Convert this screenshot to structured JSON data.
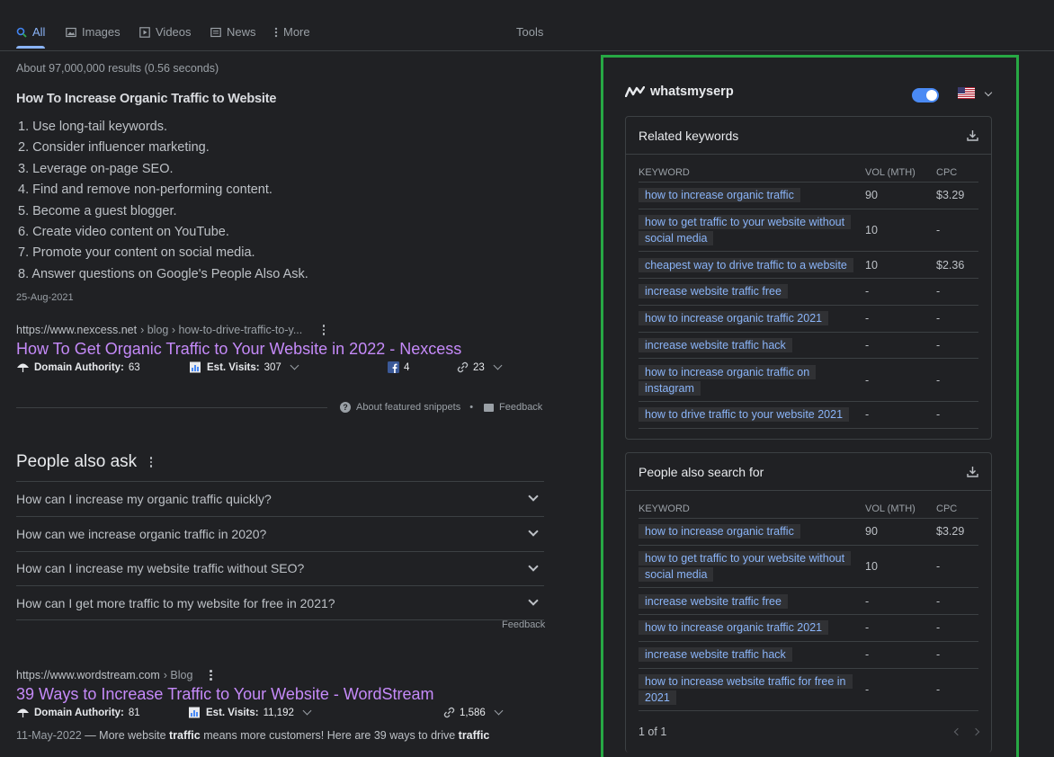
{
  "tabs": [
    {
      "label": "All",
      "icon": "search-icon",
      "active": true
    },
    {
      "label": "Images",
      "icon": "image-icon"
    },
    {
      "label": "Videos",
      "icon": "video-icon"
    },
    {
      "label": "News",
      "icon": "news-icon"
    },
    {
      "label": "More",
      "icon": "more-icon"
    }
  ],
  "tools_label": "Tools",
  "stats": "About 97,000,000 results (0.56 seconds)",
  "snippet": {
    "title": "How To Increase Organic Traffic to Website",
    "items": [
      "1. Use long-tail keywords.",
      "2. Consider influencer marketing.",
      "3. Leverage on-page SEO.",
      "4. Find and remove non-performing content.",
      "5. Become a guest blogger.",
      "6. Create video content on YouTube.",
      "7. Promote your content on social media.",
      "8. Answer questions on Google's People Also Ask."
    ],
    "date": "25-Aug-2021"
  },
  "result1": {
    "url_domain": "https://www.nexcess.net",
    "url_path": "› blog › how-to-drive-traffic-to-y...",
    "title": "How To Get Organic Traffic to Your Website in 2022 - Nexcess",
    "da_label": "Domain Authority:",
    "da_value": "63",
    "visits_label": "Est. Visits:",
    "visits_value": "307",
    "fb_value": "4",
    "links_value": "23"
  },
  "featured_footer": {
    "about": "About featured snippets",
    "sep": "•",
    "feedback": "Feedback"
  },
  "paa": {
    "title": "People also ask",
    "questions": [
      "How can I increase my organic traffic quickly?",
      "How can we increase organic traffic in 2020?",
      "How can I increase my website traffic without SEO?",
      "How can I get more traffic to my website for free in 2021?"
    ],
    "feedback": "Feedback"
  },
  "result2": {
    "url_domain": "https://www.wordstream.com",
    "url_path": "› Blog",
    "title": "39 Ways to Increase Traffic to Your Website - WordStream",
    "da_label": "Domain Authority:",
    "da_value": "81",
    "visits_label": "Est. Visits:",
    "visits_value": "11,192",
    "links_value": "1,586",
    "snippet_date": "11-May-2022",
    "snippet_text_1": " — More website ",
    "snippet_bold_1": "traffic",
    "snippet_text_2": " means more customers! Here are 39 ways to drive ",
    "snippet_bold_2": "traffic"
  },
  "panel": {
    "brand": "whatsmyserp",
    "accent": "#27a844",
    "related": {
      "title": "Related keywords",
      "headers": [
        "KEYWORD",
        "VOL (MTH)",
        "CPC"
      ],
      "rows": [
        {
          "kw": "how to increase organic traffic",
          "vol": "90",
          "cpc": "$3.29"
        },
        {
          "kw": "how to get traffic to your website without social media",
          "vol": "10",
          "cpc": "-"
        },
        {
          "kw": "cheapest way to drive traffic to a website",
          "vol": "10",
          "cpc": "$2.36"
        },
        {
          "kw": "increase website traffic free",
          "vol": "-",
          "cpc": "-"
        },
        {
          "kw": "how to increase organic traffic 2021",
          "vol": "-",
          "cpc": "-"
        },
        {
          "kw": "increase website traffic hack",
          "vol": "-",
          "cpc": "-"
        },
        {
          "kw": "how to increase organic traffic on instagram",
          "vol": "-",
          "cpc": "-"
        },
        {
          "kw": "how to drive traffic to your website 2021",
          "vol": "-",
          "cpc": "-"
        }
      ]
    },
    "also_search": {
      "title": "People also search for",
      "headers": [
        "KEYWORD",
        "VOL (MTH)",
        "CPC"
      ],
      "rows": [
        {
          "kw": "how to increase organic traffic",
          "vol": "90",
          "cpc": "$3.29"
        },
        {
          "kw": "how to get traffic to your website without social media",
          "vol": "10",
          "cpc": "-"
        },
        {
          "kw": "increase website traffic free",
          "vol": "-",
          "cpc": "-"
        },
        {
          "kw": "how to increase organic traffic 2021",
          "vol": "-",
          "cpc": "-"
        },
        {
          "kw": "increase website traffic hack",
          "vol": "-",
          "cpc": "-"
        },
        {
          "kw": "how to increase website traffic for free in 2021",
          "vol": "-",
          "cpc": "-"
        }
      ],
      "pager": "1 of 1"
    }
  }
}
